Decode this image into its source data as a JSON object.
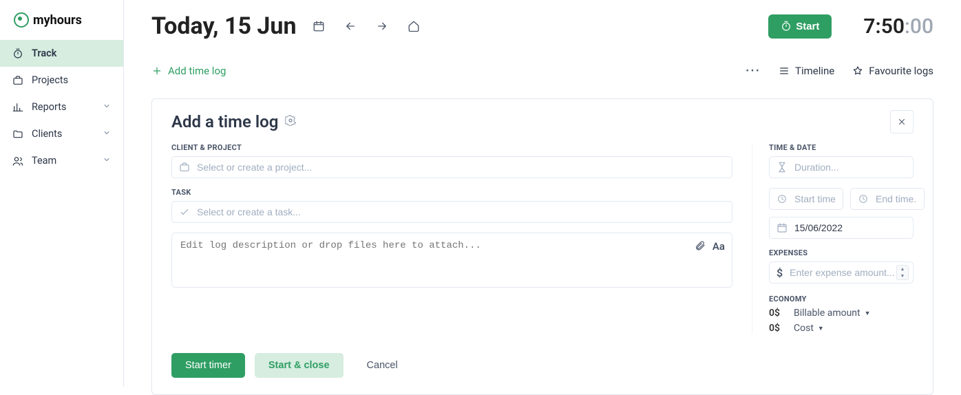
{
  "brand": {
    "name": "myhours"
  },
  "sidebar": {
    "items": [
      {
        "label": "Track",
        "icon": "stopwatch-icon",
        "active": true,
        "expandable": false
      },
      {
        "label": "Projects",
        "icon": "briefcase-icon",
        "active": false,
        "expandable": false
      },
      {
        "label": "Reports",
        "icon": "chart-icon",
        "active": false,
        "expandable": true
      },
      {
        "label": "Clients",
        "icon": "folder-icon",
        "active": false,
        "expandable": true
      },
      {
        "label": "Team",
        "icon": "users-icon",
        "active": false,
        "expandable": true
      }
    ]
  },
  "header": {
    "date_title": "Today, 15 Jun",
    "start_label": "Start",
    "clock_main": "7:50",
    "clock_seconds": ":00"
  },
  "actions": {
    "add_log": "Add time log",
    "timeline": "Timeline",
    "favourite": "Favourite logs"
  },
  "panel": {
    "title": "Add a time log",
    "labels": {
      "client_project": "CLIENT & PROJECT",
      "task": "TASK",
      "time_date": "TIME & DATE",
      "expenses": "EXPENSES",
      "economy": "ECONOMY"
    },
    "placeholders": {
      "project": "Select or create a project...",
      "task": "Select or create a task...",
      "description": "Edit log description or drop files here to attach...",
      "duration": "Duration...",
      "start_time": "Start time",
      "end_time": "End time...",
      "expense": "Enter expense amount..."
    },
    "values": {
      "date": "15/06/2022"
    },
    "economy": {
      "billable_value": "0$",
      "billable_label": "Billable amount",
      "cost_value": "0$",
      "cost_label": "Cost"
    },
    "buttons": {
      "start_timer": "Start timer",
      "start_close": "Start & close",
      "cancel": "Cancel"
    }
  }
}
